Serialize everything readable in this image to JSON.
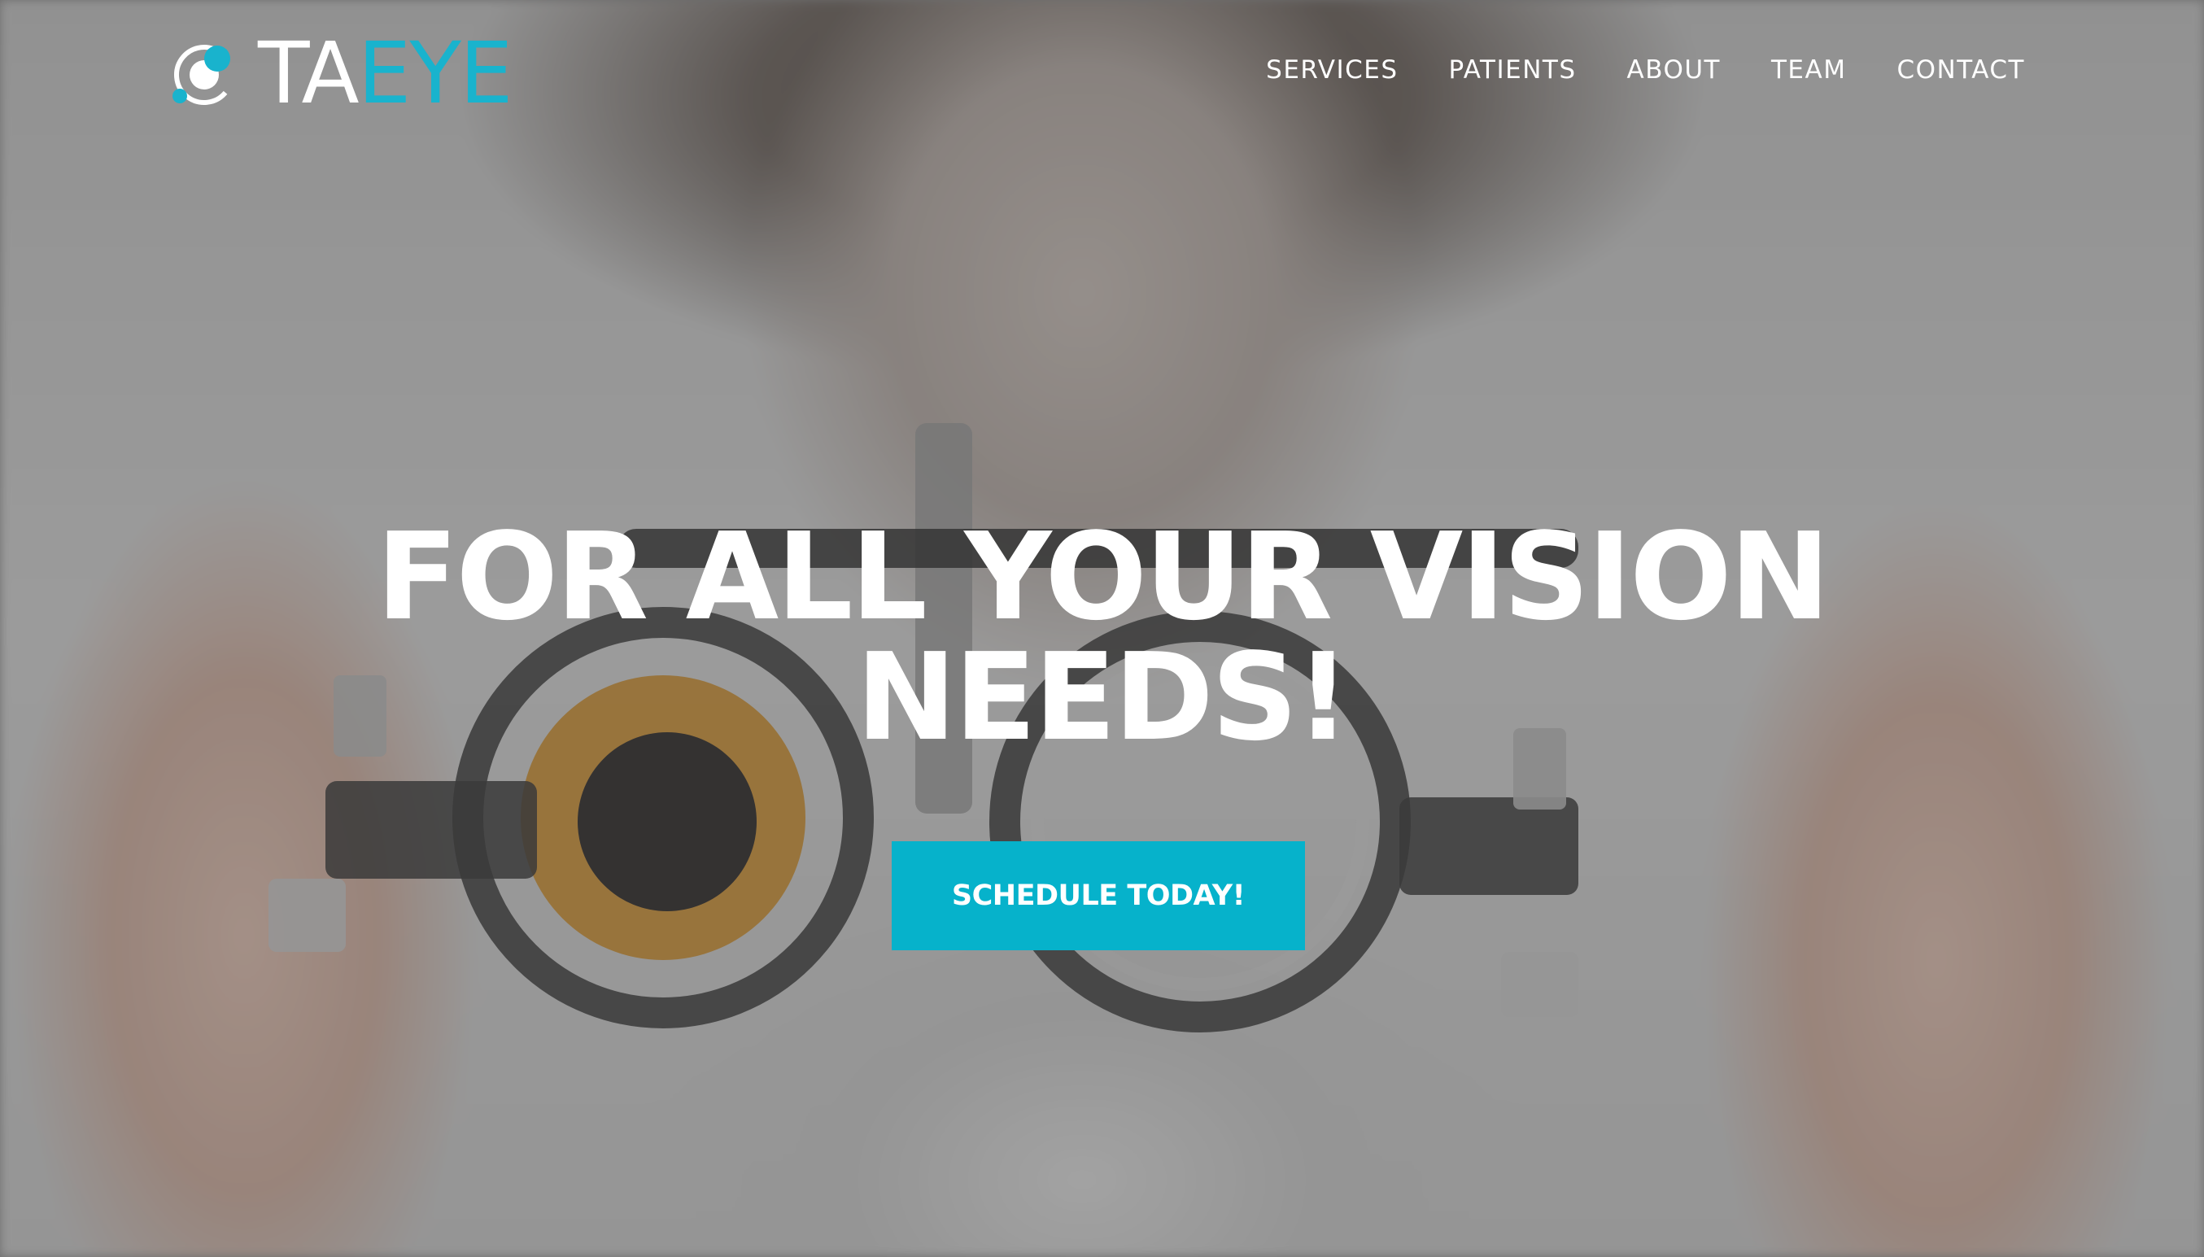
{
  "header": {
    "logo": {
      "text_white": "TA",
      "text_accent": "EYE"
    },
    "nav": [
      {
        "label": "SERVICES"
      },
      {
        "label": "PATIENTS"
      },
      {
        "label": "ABOUT"
      },
      {
        "label": "TEAM"
      },
      {
        "label": "CONTACT"
      }
    ]
  },
  "hero": {
    "headline_line1": "FOR ALL YOUR VISION",
    "headline_line2": "NEEDS!",
    "cta_label": "SCHEDULE TODAY!",
    "background": "blurred photo of a person holding an optometry trial frame"
  },
  "colors": {
    "accent": "#19b3cd",
    "button": "#06b2cb",
    "text": "#ffffff"
  }
}
